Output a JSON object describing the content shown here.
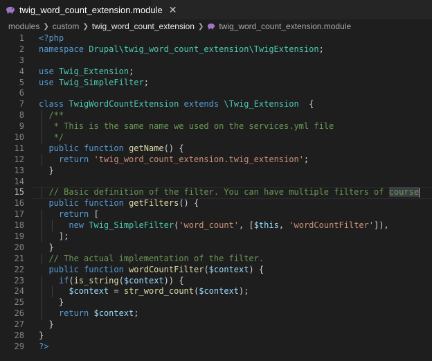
{
  "tab": {
    "title": "twig_word_count_extension.module",
    "icon": "php-elephant-icon",
    "accent": "#a074c4"
  },
  "breadcrumb": {
    "items": [
      "modules",
      "custom",
      "twig_word_count_extension"
    ],
    "file": "twig_word_count_extension.module"
  },
  "editor": {
    "current_line": 15,
    "lines": [
      {
        "n": "1",
        "tokens": [
          {
            "t": "<?php",
            "c": "kw"
          }
        ]
      },
      {
        "n": "2",
        "tokens": [
          {
            "t": "namespace ",
            "c": "kw"
          },
          {
            "t": "Drupal\\twig_word_count_extension\\TwigExtension",
            "c": "ns"
          },
          {
            "t": ";",
            "c": "pun"
          }
        ]
      },
      {
        "n": "3",
        "tokens": []
      },
      {
        "n": "4",
        "tokens": [
          {
            "t": "use ",
            "c": "kw"
          },
          {
            "t": "Twig_Extension",
            "c": "cls"
          },
          {
            "t": ";",
            "c": "pun"
          }
        ]
      },
      {
        "n": "5",
        "tokens": [
          {
            "t": "use ",
            "c": "kw"
          },
          {
            "t": "Twig_SimpleFilter",
            "c": "cls"
          },
          {
            "t": ";",
            "c": "pun"
          }
        ]
      },
      {
        "n": "6",
        "tokens": []
      },
      {
        "n": "7",
        "tokens": [
          {
            "t": "class ",
            "c": "kw"
          },
          {
            "t": "TwigWordCountExtension",
            "c": "cls"
          },
          {
            "t": " extends ",
            "c": "kw"
          },
          {
            "t": "\\Twig_Extension",
            "c": "cls"
          },
          {
            "t": "  {",
            "c": "pun"
          }
        ]
      },
      {
        "n": "8",
        "tokens": [
          {
            "t": "  /**",
            "c": "com"
          }
        ]
      },
      {
        "n": "9",
        "tokens": [
          {
            "t": "   * This is the same name we used on the services.yml file",
            "c": "com"
          }
        ]
      },
      {
        "n": "10",
        "tokens": [
          {
            "t": "   */",
            "c": "com"
          }
        ]
      },
      {
        "n": "11",
        "tokens": [
          {
            "t": "  public ",
            "c": "kw"
          },
          {
            "t": "function ",
            "c": "kw"
          },
          {
            "t": "getName",
            "c": "fn"
          },
          {
            "t": "() {",
            "c": "pun"
          }
        ]
      },
      {
        "n": "12",
        "tokens": [
          {
            "t": "    return ",
            "c": "kw"
          },
          {
            "t": "'twig_word_count_extension.twig_extension'",
            "c": "str"
          },
          {
            "t": ";",
            "c": "pun"
          }
        ]
      },
      {
        "n": "13",
        "tokens": [
          {
            "t": "  }",
            "c": "pun"
          }
        ]
      },
      {
        "n": "14",
        "tokens": []
      },
      {
        "n": "15",
        "tokens": [
          {
            "t": "  // Basic definition of the filter. You can have multiple filters of ",
            "c": "com"
          },
          {
            "t": "course",
            "c": "com",
            "hl": true
          },
          {
            "t": "",
            "c": "com",
            "cursor": true
          }
        ]
      },
      {
        "n": "16",
        "tokens": [
          {
            "t": "  public ",
            "c": "kw"
          },
          {
            "t": "function ",
            "c": "kw"
          },
          {
            "t": "getFilters",
            "c": "fn"
          },
          {
            "t": "() {",
            "c": "pun"
          }
        ]
      },
      {
        "n": "17",
        "tokens": [
          {
            "t": "    return ",
            "c": "kw"
          },
          {
            "t": "[",
            "c": "pun"
          }
        ]
      },
      {
        "n": "18",
        "tokens": [
          {
            "t": "      new ",
            "c": "kw"
          },
          {
            "t": "Twig_SimpleFilter",
            "c": "cls"
          },
          {
            "t": "(",
            "c": "pun"
          },
          {
            "t": "'word_count'",
            "c": "str"
          },
          {
            "t": ", [",
            "c": "pun"
          },
          {
            "t": "$this",
            "c": "var"
          },
          {
            "t": ", ",
            "c": "pun"
          },
          {
            "t": "'wordCountFilter'",
            "c": "str"
          },
          {
            "t": "]),",
            "c": "pun"
          }
        ]
      },
      {
        "n": "19",
        "tokens": [
          {
            "t": "    ];",
            "c": "pun"
          }
        ]
      },
      {
        "n": "20",
        "tokens": [
          {
            "t": "  }",
            "c": "pun"
          }
        ]
      },
      {
        "n": "21",
        "tokens": [
          {
            "t": "  // The actual implementation of the filter.",
            "c": "com"
          }
        ]
      },
      {
        "n": "22",
        "tokens": [
          {
            "t": "  public ",
            "c": "kw"
          },
          {
            "t": "function ",
            "c": "kw"
          },
          {
            "t": "wordCountFilter",
            "c": "fn"
          },
          {
            "t": "(",
            "c": "pun"
          },
          {
            "t": "$context",
            "c": "var"
          },
          {
            "t": ") {",
            "c": "pun"
          }
        ]
      },
      {
        "n": "23",
        "tokens": [
          {
            "t": "    if",
            "c": "kw"
          },
          {
            "t": "(",
            "c": "pun"
          },
          {
            "t": "is_string",
            "c": "fn"
          },
          {
            "t": "(",
            "c": "pun"
          },
          {
            "t": "$context",
            "c": "var"
          },
          {
            "t": ")) {",
            "c": "pun"
          }
        ]
      },
      {
        "n": "24",
        "tokens": [
          {
            "t": "      ",
            "c": "pun"
          },
          {
            "t": "$context",
            "c": "var"
          },
          {
            "t": " = ",
            "c": "pun"
          },
          {
            "t": "str_word_count",
            "c": "fn"
          },
          {
            "t": "(",
            "c": "pun"
          },
          {
            "t": "$context",
            "c": "var"
          },
          {
            "t": ");",
            "c": "pun"
          }
        ]
      },
      {
        "n": "25",
        "tokens": [
          {
            "t": "    }",
            "c": "pun"
          }
        ]
      },
      {
        "n": "26",
        "tokens": [
          {
            "t": "    return ",
            "c": "kw"
          },
          {
            "t": "$context",
            "c": "var"
          },
          {
            "t": ";",
            "c": "pun"
          }
        ]
      },
      {
        "n": "27",
        "tokens": [
          {
            "t": "  }",
            "c": "pun"
          }
        ]
      },
      {
        "n": "28",
        "tokens": [
          {
            "t": "}",
            "c": "pun"
          }
        ]
      },
      {
        "n": "29",
        "tokens": [
          {
            "t": "?>",
            "c": "kw"
          }
        ]
      }
    ]
  }
}
